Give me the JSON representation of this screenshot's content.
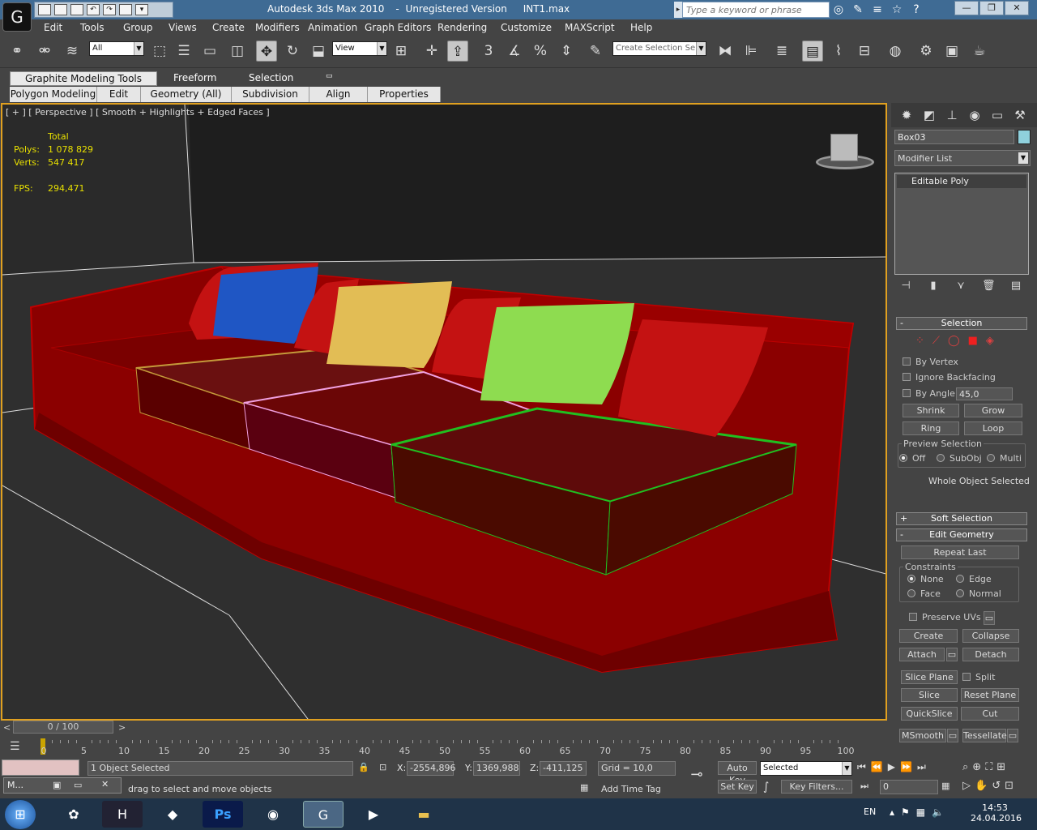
{
  "window": {
    "app": "Autodesk 3ds Max  2010",
    "registration": "Unregistered Version",
    "file": "INT1.max"
  },
  "search": {
    "placeholder": "Type a keyword or phrase"
  },
  "menu": [
    "Edit",
    "Tools",
    "Group",
    "Views",
    "Create",
    "Modifiers",
    "Animation",
    "Graph Editors",
    "Rendering",
    "Customize",
    "MAXScript",
    "Help"
  ],
  "toolbar": {
    "selection_filter": "All",
    "ref_coord": "View",
    "named_selection": "Create Selection Se"
  },
  "ribbon": {
    "tabs": [
      "Graphite Modeling Tools",
      "Freeform",
      "Selection"
    ],
    "panels": [
      "Polygon Modeling",
      "Edit",
      "Geometry (All)",
      "Subdivision",
      "Align",
      "Properties"
    ]
  },
  "viewport": {
    "label": "[ + ] [ Perspective ] [ Smooth + Highlights + Edged Faces ]",
    "stats": {
      "total_label": "Total",
      "polys_label": "Polys:",
      "polys": "1 078 829",
      "verts_label": "Verts:",
      "verts": "547 417",
      "fps_label": "FPS:",
      "fps": "294,471"
    }
  },
  "cmd": {
    "object_name": "Box03",
    "modifier_list": "Modifier List",
    "stack_item": "Editable Poly",
    "object_color": "#8fd0dc",
    "selection": {
      "title": "Selection",
      "by_vertex": "By Vertex",
      "ignore_backfacing": "Ignore Backfacing",
      "by_angle": "By Angle:",
      "angle": "45,0",
      "shrink": "Shrink",
      "grow": "Grow",
      "ring": "Ring",
      "loop": "Loop",
      "preview": "Preview Selection",
      "off": "Off",
      "subobj": "SubObj",
      "multi": "Multi",
      "status": "Whole Object Selected"
    },
    "soft_selection": "Soft Selection",
    "edit_geometry": {
      "title": "Edit Geometry",
      "repeat_last": "Repeat Last",
      "constraints": "Constraints",
      "none": "None",
      "edge": "Edge",
      "face": "Face",
      "normal": "Normal",
      "preserve_uvs": "Preserve UVs",
      "create": "Create",
      "collapse": "Collapse",
      "attach": "Attach",
      "detach": "Detach",
      "slice_plane": "Slice Plane",
      "split": "Split",
      "slice": "Slice",
      "reset_plane": "Reset Plane",
      "quickslice": "QuickSlice",
      "cut": "Cut",
      "msmooth": "MSmooth",
      "tessellate": "Tessellate"
    }
  },
  "timeline": {
    "frame": "0 / 100",
    "ticks": [
      "0",
      "5",
      "10",
      "15",
      "20",
      "25",
      "30",
      "35",
      "40",
      "45",
      "50",
      "55",
      "60",
      "65",
      "70",
      "75",
      "80",
      "85",
      "90",
      "95",
      "100"
    ]
  },
  "status": {
    "selected": "1 Object Selected",
    "prompt": "drag to select and move objects",
    "x_label": "X:",
    "x": "-2554,896",
    "y_label": "Y:",
    "y": "1369,988",
    "z_label": "Z:",
    "z": "-411,125",
    "grid": "Grid = 10,0",
    "add_time_tag": "Add Time Tag",
    "auto_key": "Auto Key",
    "set_key": "Set Key",
    "key_mode": "Selected",
    "key_filters": "Key Filters...",
    "frame_field": "0",
    "maxscript": "M..."
  },
  "taskbar": {
    "lang": "EN",
    "time": "14:53",
    "date": "24.04.2016"
  }
}
